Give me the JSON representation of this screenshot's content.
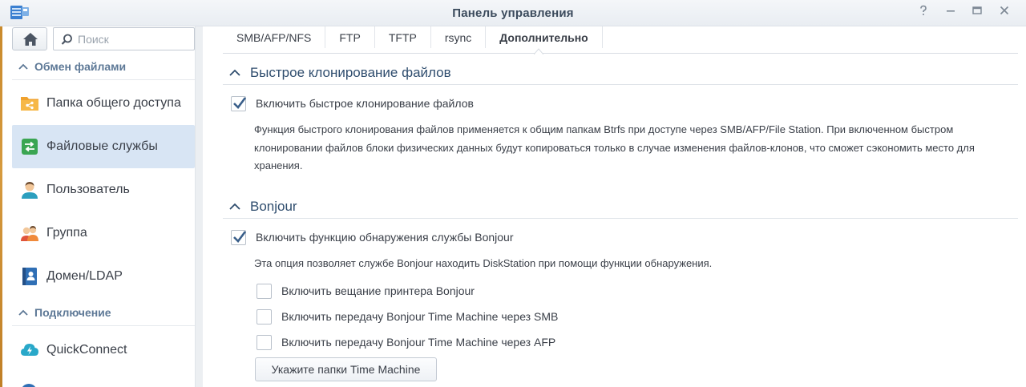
{
  "window": {
    "title": "Панель управления",
    "help_icon": "question-icon",
    "minimize_icon": "minimize-icon",
    "maximize_icon": "maximize-icon",
    "close_icon": "close-icon"
  },
  "sidebar": {
    "search_placeholder": "Поиск",
    "section_file_sharing": "Обмен файлами",
    "items": [
      {
        "label": "Папка общего доступа",
        "icon": "shared-folder-icon",
        "active": false
      },
      {
        "label": "Файловые службы",
        "icon": "file-services-icon",
        "active": true
      },
      {
        "label": "Пользователь",
        "icon": "user-icon",
        "active": false
      },
      {
        "label": "Группа",
        "icon": "group-icon",
        "active": false
      },
      {
        "label": "Домен/LDAP",
        "icon": "domain-ldap-icon",
        "active": false
      }
    ],
    "section_connectivity": "Подключение",
    "items2": [
      {
        "label": "QuickConnect",
        "icon": "quickconnect-icon",
        "active": false
      }
    ]
  },
  "tabs": [
    {
      "label": "SMB/AFP/NFS",
      "active": false
    },
    {
      "label": "FTP",
      "active": false
    },
    {
      "label": "TFTP",
      "active": false
    },
    {
      "label": "rsync",
      "active": false
    },
    {
      "label": "Дополнительно",
      "active": true
    }
  ],
  "fast_clone": {
    "title": "Быстрое клонирование файлов",
    "enable_label": "Включить быстрое клонирование файлов",
    "enabled": true,
    "description": "Функция быстрого клонирования файлов применяется к общим папкам Btrfs при доступе через SMB/AFP/File Station. При включенном быстром клонировании файлов блоки физических данных будут копироваться только в случае изменения файлов-клонов, что сможет сэкономить место для хранения."
  },
  "bonjour": {
    "title": "Bonjour",
    "enable_label": "Включить функцию обнаружения службы Bonjour",
    "enabled": true,
    "description": "Эта опция позволяет службе Bonjour находить DiskStation при помощи функции обнаружения.",
    "options": [
      {
        "label": "Включить вещание принтера Bonjour",
        "checked": false
      },
      {
        "label": "Включить передачу Bonjour Time Machine через SMB",
        "checked": false
      },
      {
        "label": "Включить передачу Bonjour Time Machine через AFP",
        "checked": false
      }
    ],
    "button_label": "Укажите папки Time Machine"
  },
  "colors": {
    "accent": "#2f6fb5",
    "active_item_bg": "#d8e5f4",
    "section_heading": "#5d7896",
    "fieldset_title": "#2f4d6e"
  }
}
